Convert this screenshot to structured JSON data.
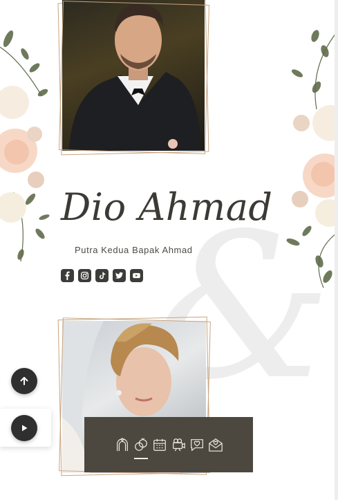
{
  "groom": {
    "name": "Dio Ahmad",
    "parents": "Putra Kedua Bapak Ahmad"
  },
  "decor": {
    "ampersand": "&"
  },
  "socials": [
    {
      "name": "facebook",
      "icon": "facebook-icon"
    },
    {
      "name": "instagram",
      "icon": "instagram-icon"
    },
    {
      "name": "tiktok",
      "icon": "tiktok-icon"
    },
    {
      "name": "twitter",
      "icon": "twitter-icon"
    },
    {
      "name": "youtube",
      "icon": "youtube-icon"
    }
  ],
  "bottom_nav": {
    "items": [
      {
        "icon": "wedding-arch-icon",
        "active": false
      },
      {
        "icon": "couple-rings-icon",
        "active": true
      },
      {
        "icon": "calendar-icon",
        "active": false
      },
      {
        "icon": "camera-icon",
        "active": false
      },
      {
        "icon": "chat-heart-icon",
        "active": false
      },
      {
        "icon": "envelope-heart-icon",
        "active": false
      }
    ]
  },
  "floating": {
    "scroll_top_icon": "arrow-up-icon",
    "music_icon": "play-icon"
  },
  "colors": {
    "nav_bg": "#4d483f",
    "frame": "#c8a37e",
    "text_dark": "#3b3a35",
    "button_dark": "#2f2f2f"
  }
}
